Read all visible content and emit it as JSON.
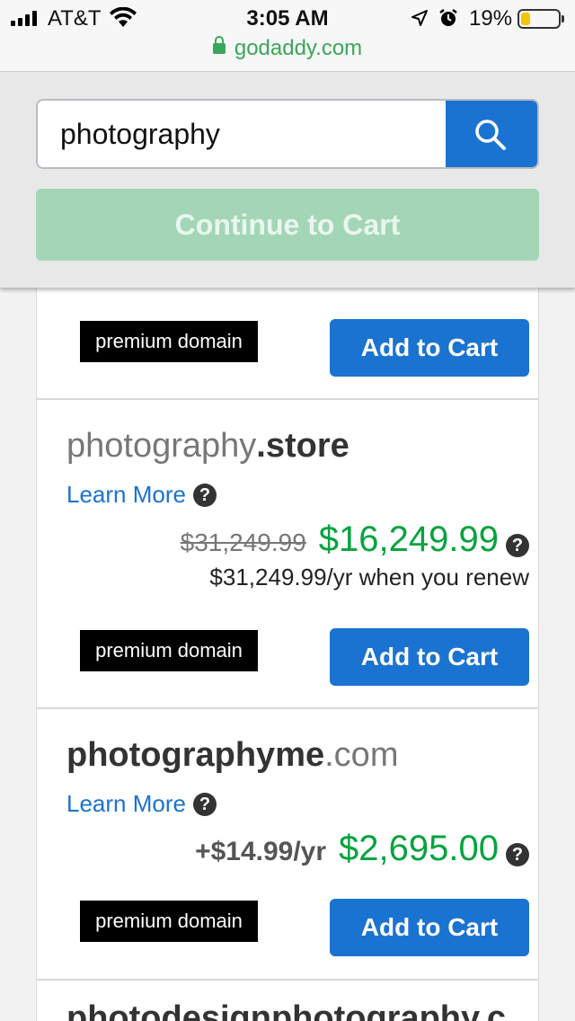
{
  "status_bar": {
    "carrier": "AT&T",
    "time": "3:05 AM",
    "battery_percent": "19%",
    "battery_level": 0.19,
    "icons": [
      "signal-icon",
      "wifi-icon",
      "location-arrow-icon",
      "alarm-icon",
      "battery-icon"
    ]
  },
  "browser": {
    "url": "godaddy.com"
  },
  "search": {
    "query": "photography",
    "button_icon": "search-icon"
  },
  "continue_label": "Continue to Cart",
  "colors": {
    "accent_blue": "#1a73d0",
    "price_green": "#06a33e",
    "continue_disabled": "#a3d6b6",
    "url_green": "#3aa65a"
  },
  "results": {
    "partial_top": {
      "badge": "premium domain",
      "add_label": "Add to Cart"
    },
    "items": [
      {
        "sld": "photography",
        "tld": ".store",
        "learn_more": "Learn More",
        "old_price": "$31,249.99",
        "price": "$16,249.99",
        "renew": "$31,249.99/yr when you renew",
        "badge": "premium domain",
        "add_label": "Add to Cart"
      },
      {
        "sld": "photographyme",
        "tld": ".com",
        "learn_more": "Learn More",
        "addon": "+$14.99/yr",
        "price": "$2,695.00",
        "badge": "premium domain",
        "add_label": "Add to Cart"
      }
    ],
    "partial_bottom": {
      "domain": "photodesignphotography.c"
    }
  }
}
